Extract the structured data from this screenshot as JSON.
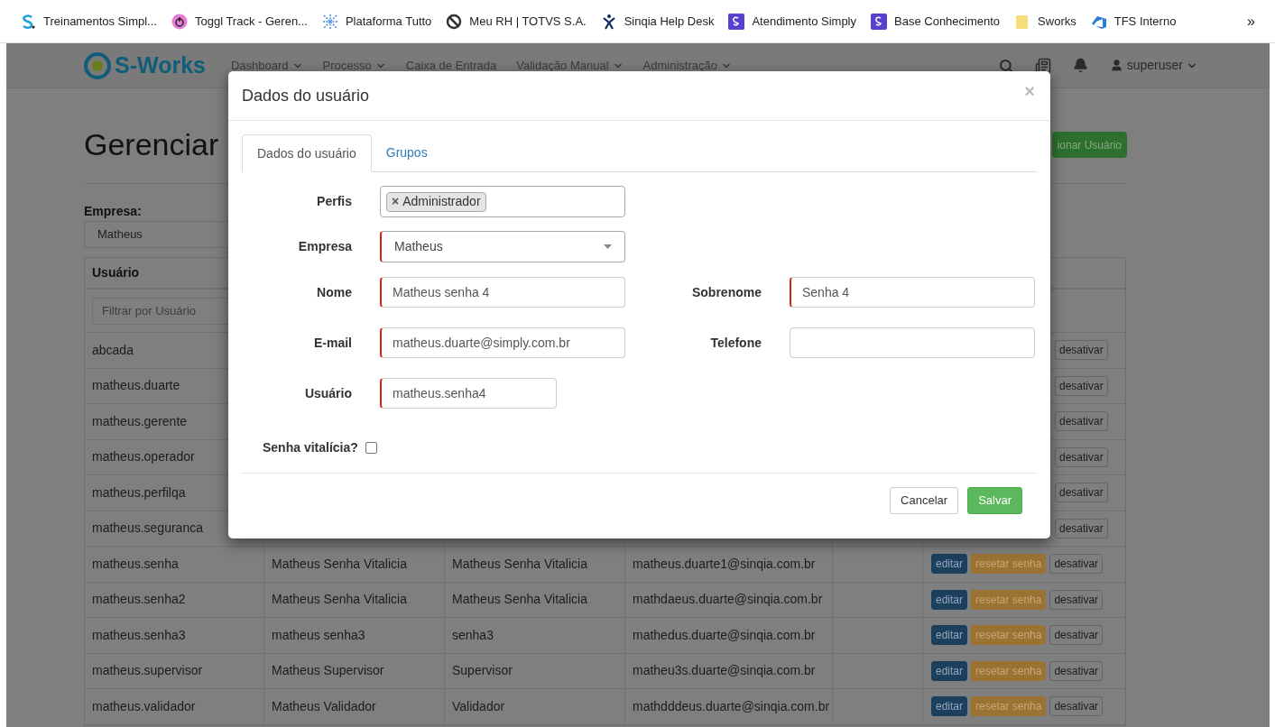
{
  "bookmarks": [
    {
      "label": "Treinamentos Simpl...",
      "kind": "letter-s"
    },
    {
      "label": "Toggl Track - Geren...",
      "kind": "power"
    },
    {
      "label": "Plataforma Tutto",
      "kind": "network"
    },
    {
      "label": "Meu RH | TOTVS S.A.",
      "kind": "ring"
    },
    {
      "label": "Sinqia Help Desk",
      "kind": "figure"
    },
    {
      "label": "Atendimento Simply",
      "kind": "tile"
    },
    {
      "label": "Base Conhecimento",
      "kind": "tile"
    },
    {
      "label": "Sworks",
      "kind": "folder"
    },
    {
      "label": "TFS Interno",
      "kind": "cloud"
    }
  ],
  "bookmarks_more": "»",
  "navbar": {
    "logo": "S-Works",
    "menu": [
      {
        "label": "Dashboard",
        "dropdown": true
      },
      {
        "label": "Processo",
        "dropdown": true
      },
      {
        "label": "Caixa de Entrada",
        "dropdown": false
      },
      {
        "label": "Validação Manual",
        "dropdown": true
      },
      {
        "label": "Administração",
        "dropdown": true
      }
    ],
    "user": "superuser"
  },
  "page": {
    "title": "Gerenciar",
    "add_button": "ionar Usuário",
    "company_label": "Empresa:",
    "company_value": "Matheus"
  },
  "table": {
    "columns": [
      "Usuário"
    ],
    "filter_placeholder": "Filtrar por Usuário",
    "rows": [
      {
        "username": "abcada",
        "actions": [
          "desativar"
        ]
      },
      {
        "username": "matheus.duarte",
        "actions": [
          "desativar"
        ]
      },
      {
        "username": "matheus.gerente",
        "actions": [
          "desativar"
        ]
      },
      {
        "username": "matheus.operador",
        "actions": [
          "desativar"
        ]
      },
      {
        "username": "matheus.perfilqa",
        "actions": [
          "desativar"
        ]
      },
      {
        "username": "matheus.seguranca",
        "actions": [
          "desativar"
        ]
      },
      {
        "username": "matheus.senha",
        "name": "Matheus Senha Vitalicia",
        "surname": "Matheus Senha Vitalicia",
        "email": "matheus.duarte1@sinqia.com.br",
        "actions": [
          "editar",
          "resetar senha",
          "desativar"
        ]
      },
      {
        "username": "matheus.senha2",
        "name": "Matheus Senha Vitalicia",
        "surname": "Matheus Senha Vitalicia",
        "email": "mathdaeus.duarte@sinqia.com.br",
        "actions": [
          "editar",
          "resetar senha",
          "desativar"
        ]
      },
      {
        "username": "matheus.senha3",
        "name": "matheus senha3",
        "surname": "senha3",
        "email": "mathedus.duarte@sinqia.com.br",
        "actions": [
          "editar",
          "resetar senha",
          "desativar"
        ]
      },
      {
        "username": "matheus.supervisor",
        "name": "Matheus Supervisor",
        "surname": "Supervisor",
        "email": "matheu3s.duarte@sinqia.com.br",
        "actions": [
          "editar",
          "resetar senha",
          "desativar"
        ]
      },
      {
        "username": "matheus.validador",
        "name": "Matheus Validador",
        "surname": "Validador",
        "email": "mathdddeus.duarte@sinqia.com.br",
        "actions": [
          "editar",
          "resetar senha",
          "desativar"
        ]
      }
    ]
  },
  "modal": {
    "title": "Dados do usuário",
    "close": "×",
    "tabs": [
      {
        "label": "Dados do usuário",
        "selected": true
      },
      {
        "label": "Grupos",
        "selected": false
      }
    ],
    "profiles": {
      "label": "Perfis",
      "tags": [
        {
          "remove": "×",
          "label": "Administrador"
        }
      ]
    },
    "company": {
      "label": "Empresa",
      "value": "Matheus",
      "required": true
    },
    "fields": [
      {
        "label": "Nome",
        "value": "Matheus senha 4",
        "required": true
      },
      {
        "label": "Sobrenome",
        "value": "Senha 4",
        "required": true
      },
      {
        "label": "E-mail",
        "value": "matheus.duarte@simply.com.br",
        "required": true
      },
      {
        "label": "Telefone",
        "required": false
      }
    ],
    "username": {
      "label": "Usuário",
      "value": "matheus.senha4",
      "required": true
    },
    "lifetime_password": {
      "label": "Senha vitalícia?",
      "checked": false
    },
    "buttons": [
      {
        "label": "Cancelar",
        "kind": "default"
      },
      {
        "label": "Salvar",
        "kind": "primary"
      }
    ]
  }
}
